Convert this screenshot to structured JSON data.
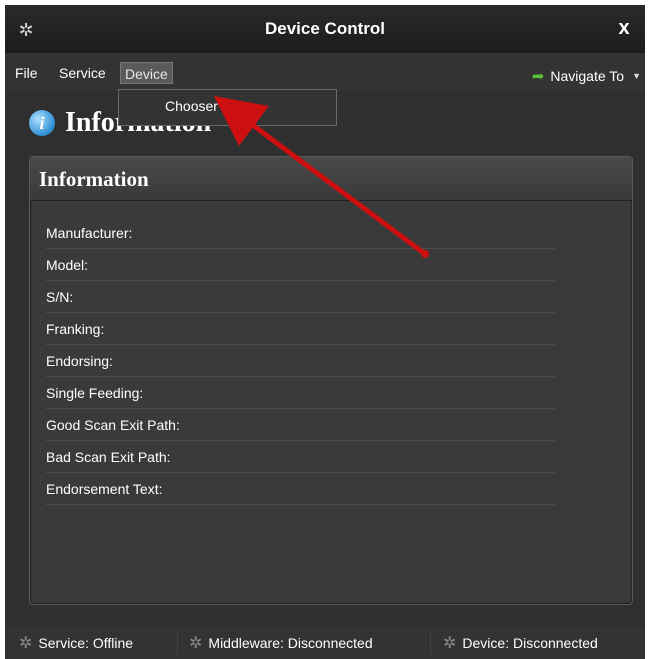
{
  "window": {
    "title": "Device Control",
    "close_glyph": "x",
    "app_icon": "recycle-icon"
  },
  "menubar": {
    "items": [
      "File",
      "Service",
      "Device"
    ],
    "active_item": "Device",
    "navigate_label": "Navigate To",
    "navigate_icon": "green-arrow-icon"
  },
  "dropdown": {
    "items": [
      "Chooser"
    ]
  },
  "section": {
    "header_title": "Information",
    "header_icon": "info-icon"
  },
  "panel": {
    "title": "Information",
    "fields": [
      "Manufacturer:",
      "Model:",
      "S/N:",
      "Franking:",
      "Endorsing:",
      "Single Feeding:",
      "Good Scan Exit Path:",
      "Bad Scan Exit Path:",
      "Endorsement Text:"
    ]
  },
  "statusbar": {
    "service": "Service: Offline",
    "middleware": "Middleware: Disconnected",
    "device": "Device: Disconnected"
  },
  "annotation": {
    "arrow_color": "#cc1010"
  },
  "colors": {
    "window_bg": "#2f2f2f",
    "accent_green": "#5bbf3a",
    "info_blue": "#2d8fd6"
  }
}
